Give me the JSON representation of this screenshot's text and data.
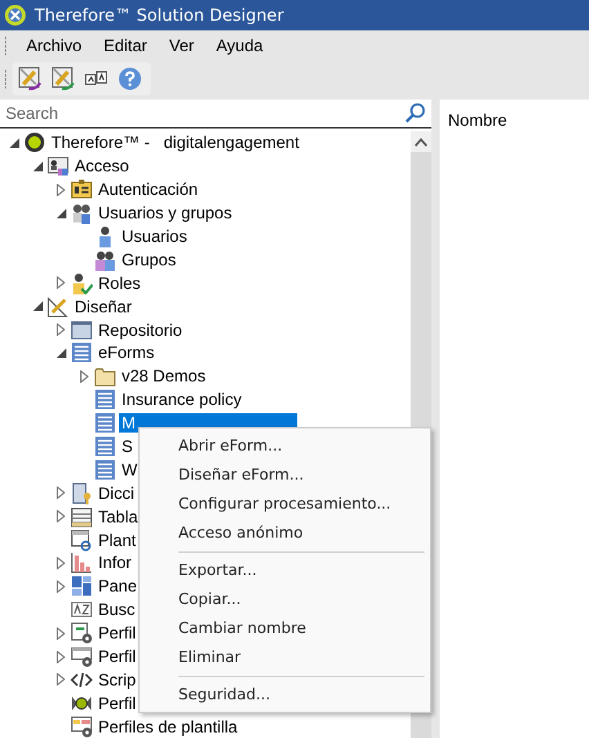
{
  "window": {
    "title": "Therefore™ Solution Designer"
  },
  "menu_bar": [
    "Archivo",
    "Editar",
    "Ver",
    "Ayuda"
  ],
  "search": {
    "placeholder": "Search"
  },
  "tree": [
    {
      "label": "Therefore™ -   digitalengagement",
      "kind": "server",
      "expanded": true,
      "selected": false,
      "children": [
        {
          "label": "Acceso",
          "kind": "access",
          "expanded": true,
          "selected": false,
          "children": [
            {
              "label": "Autenticación",
              "kind": "auth",
              "expanded": false,
              "selected": false
            },
            {
              "label": "Usuarios y grupos",
              "kind": "users",
              "expanded": true,
              "selected": false,
              "children": [
                {
                  "label": "Usuarios",
                  "kind": "user",
                  "selected": false
                },
                {
                  "label": "Grupos",
                  "kind": "group",
                  "selected": false
                }
              ]
            },
            {
              "label": "Roles",
              "kind": "roles",
              "expanded": false,
              "selected": false
            }
          ]
        },
        {
          "label": "Diseñar",
          "kind": "design",
          "expanded": true,
          "selected": false,
          "children": [
            {
              "label": "Repositorio",
              "kind": "repository",
              "expanded": false,
              "selected": false
            },
            {
              "label": "eForms",
              "kind": "eform",
              "expanded": true,
              "selected": false,
              "children": [
                {
                  "label": "v28 Demos",
                  "kind": "folder",
                  "expanded": false,
                  "selected": false
                },
                {
                  "label": "Insurance policy",
                  "kind": "eform",
                  "selected": false
                },
                {
                  "label": "M",
                  "kind": "eform",
                  "selected": true
                },
                {
                  "label": "S",
                  "kind": "eform",
                  "selected": false
                },
                {
                  "label": "W",
                  "kind": "eform",
                  "selected": false
                }
              ]
            },
            {
              "label": "Dicci",
              "kind": "dictionary",
              "expanded": false,
              "selected": false
            },
            {
              "label": "Tabla",
              "kind": "table",
              "expanded": false,
              "selected": false
            },
            {
              "label": "Plant",
              "kind": "template",
              "selected": false
            },
            {
              "label": "Infor",
              "kind": "report",
              "expanded": false,
              "selected": false
            },
            {
              "label": "Pane",
              "kind": "dashboard",
              "expanded": false,
              "selected": false
            },
            {
              "label": "Busc",
              "kind": "search",
              "selected": false
            },
            {
              "label": "Perfil",
              "kind": "profile-in",
              "expanded": false,
              "selected": false
            },
            {
              "label": "Perfil",
              "kind": "profile-out",
              "expanded": false,
              "selected": false
            },
            {
              "label": "Scrip",
              "kind": "script",
              "expanded": false,
              "selected": false
            },
            {
              "label": "Perfil",
              "kind": "capture",
              "selected": false
            },
            {
              "label": "Perfiles de plantilla",
              "kind": "template-profile",
              "selected": false
            }
          ]
        }
      ]
    }
  ],
  "list_panel": {
    "columns": [
      "Nombre"
    ]
  },
  "context_menu": [
    {
      "kind": "item",
      "label": "Abrir eForm..."
    },
    {
      "kind": "item",
      "label": "Diseñar eForm..."
    },
    {
      "kind": "item",
      "label": "Configurar procesamiento..."
    },
    {
      "kind": "item",
      "label": "Acceso anónimo"
    },
    {
      "kind": "separator"
    },
    {
      "kind": "item",
      "label": "Exportar..."
    },
    {
      "kind": "item",
      "label": "Copiar..."
    },
    {
      "kind": "item",
      "label": "Cambiar nombre"
    },
    {
      "kind": "item",
      "label": "Eliminar"
    },
    {
      "kind": "separator"
    },
    {
      "kind": "item",
      "label": "Seguridad..."
    }
  ]
}
